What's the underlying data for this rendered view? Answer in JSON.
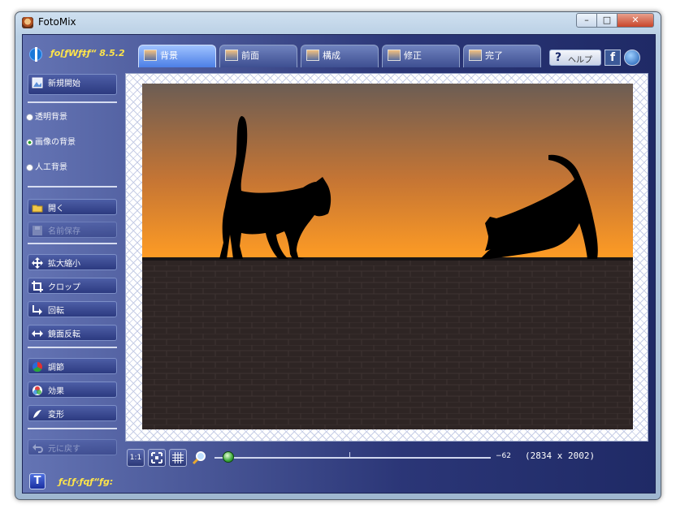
{
  "window": {
    "title": "FotoMix",
    "minimize_symbol": "–",
    "maximize_symbol": "□",
    "close_symbol": "✕"
  },
  "header": {
    "version": "ƒo[ƒWƒ‡ƒ“ 8.5.2",
    "tabs": [
      {
        "label": "背景",
        "active": true
      },
      {
        "label": "前面",
        "active": false
      },
      {
        "label": "構成",
        "active": false
      },
      {
        "label": "修正",
        "active": false
      },
      {
        "label": "完了",
        "active": false
      }
    ],
    "help": {
      "symbol": "?",
      "label": "ヘルプ"
    },
    "facebook": {
      "symbol": "f"
    }
  },
  "sidebar": {
    "new_label": "新規開始",
    "radios": [
      {
        "label": "透明背景",
        "selected": false
      },
      {
        "label": "画像の背景",
        "selected": true
      },
      {
        "label": "人工背景",
        "selected": false
      }
    ],
    "open_label": "開く",
    "save_label": "名前保存",
    "tools": [
      {
        "label": "拡大縮小",
        "icon": "move-arrows-icon"
      },
      {
        "label": "クロップ",
        "icon": "crop-icon"
      },
      {
        "label": "回転",
        "icon": "rotate-icon"
      },
      {
        "label": "鏡面反転",
        "icon": "flip-icon"
      }
    ],
    "adjust_label": "調節",
    "effects_label": "効果",
    "transform_label": "変形",
    "undo_label": "元に戻す"
  },
  "viewbar": {
    "actual_size_label": "1:1",
    "zoom_value": "−62",
    "zoom_fraction": 0.05,
    "dimensions": "(2834 x 2002)"
  },
  "status": {
    "icon_letter": "T",
    "text": "ƒc[ƒ‹ƒqƒ“ƒg:"
  },
  "colors": {
    "accent_yellow": "#ffe54a",
    "sunset_top": "#705e52",
    "sunset_bottom": "#ff9a22",
    "brick": "#2e2524"
  }
}
